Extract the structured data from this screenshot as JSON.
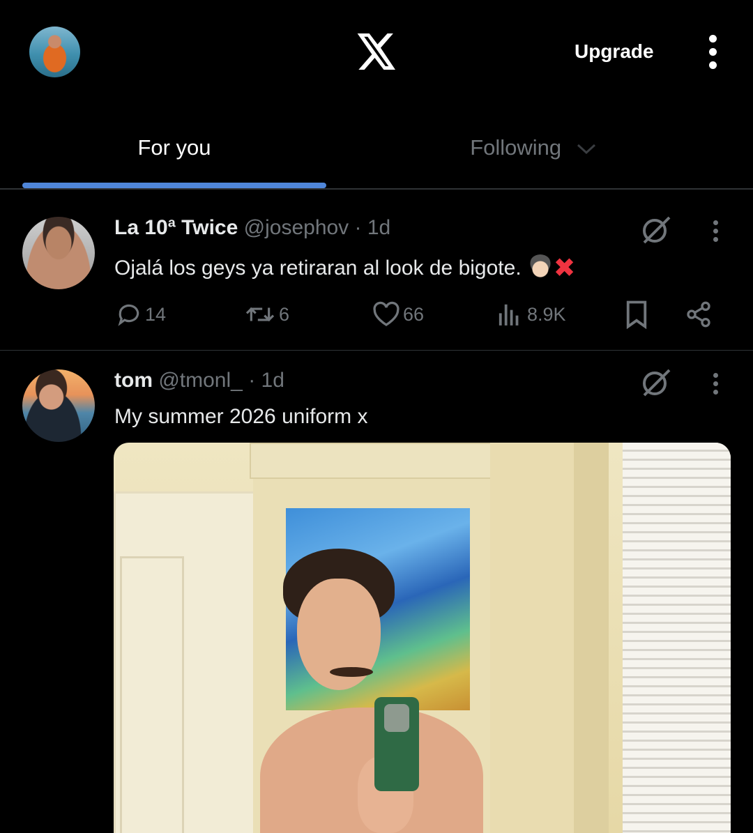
{
  "header": {
    "upgrade_label": "Upgrade",
    "logo_icon": "x-logo-icon",
    "menu_icon": "more-vertical-icon"
  },
  "tabs": [
    {
      "label": "For you",
      "selected": true
    },
    {
      "label": "Following",
      "selected": false
    }
  ],
  "posts": [
    {
      "name": "La 10ª Twice",
      "handle": "@josephov",
      "separator": "·",
      "time": "1d",
      "text": "Ojalá los geys ya retiraran al look de bigote.",
      "emojis": [
        "boy-emoji",
        "cross-mark-emoji"
      ],
      "stats": {
        "replies": "14",
        "reposts": "6",
        "likes": "66",
        "views": "8.9K"
      }
    },
    {
      "name": "tom",
      "handle": "@tmonl_",
      "separator": "·",
      "time": "1d",
      "text": "My summer 2026 uniform x",
      "has_media": true
    }
  ],
  "colors": {
    "background": "#000000",
    "text_primary": "#e7e9ea",
    "text_secondary": "#71767b",
    "tab_indicator": "#4f86d9",
    "divider": "#2f3336"
  }
}
